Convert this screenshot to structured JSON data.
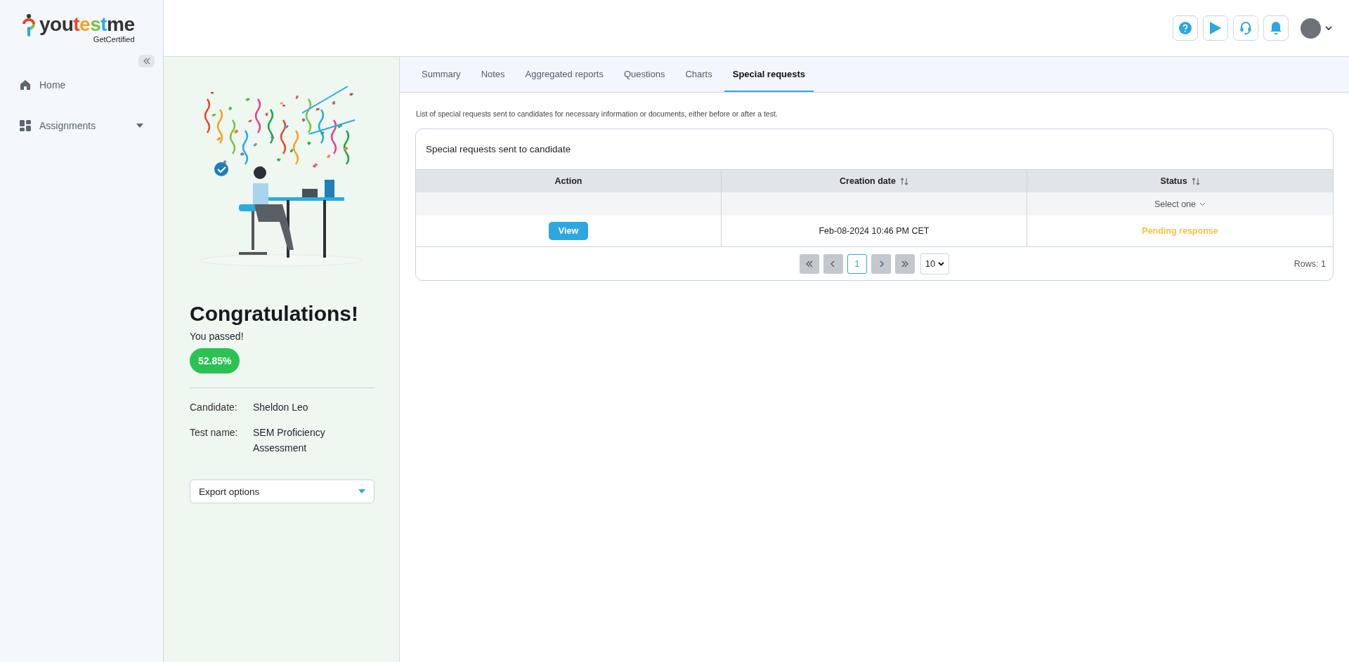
{
  "logo": {
    "parts": [
      {
        "text": "you",
        "color": "#333333"
      },
      {
        "text": "t",
        "color": "#e8452c"
      },
      {
        "text": "e",
        "color": "#f7a21b"
      },
      {
        "text": "s",
        "color": "#7cc242"
      },
      {
        "text": "t",
        "color": "#29aae1"
      },
      {
        "text": "me",
        "color": "#333333"
      }
    ],
    "tagline": "GetCertified"
  },
  "sidebar": {
    "items": [
      {
        "label": "Home",
        "expandable": false
      },
      {
        "label": "Assignments",
        "expandable": true
      }
    ]
  },
  "result": {
    "title": "Congratulations!",
    "subtitle": "You passed!",
    "score": "52.85%",
    "passed": true,
    "details": [
      {
        "label": "Candidate:",
        "value": "Sheldon Leo"
      },
      {
        "label": "Test name:",
        "value": "SEM Proficiency Assessment"
      }
    ],
    "export": {
      "value": "Export options"
    }
  },
  "tabs": [
    {
      "label": "Summary",
      "selected": false
    },
    {
      "label": "Notes",
      "selected": false
    },
    {
      "label": "Aggregated reports",
      "selected": false
    },
    {
      "label": "Questions",
      "selected": false
    },
    {
      "label": "Charts",
      "selected": false
    },
    {
      "label": "Special requests",
      "selected": true
    }
  ],
  "description": "List of special requests sent to candidates for necessary information or documents, either before or after a test.",
  "table": {
    "title": "Special requests sent to candidate",
    "columns": [
      {
        "label": "Action",
        "sortable": false
      },
      {
        "label": "Creation date",
        "sortable": true
      },
      {
        "label": "Status",
        "sortable": true,
        "filter": "Select one"
      }
    ],
    "rows": [
      {
        "action": "View",
        "date": "Feb-08-2024 10:46 PM CET",
        "status": "Pending response",
        "kind": "pending"
      }
    ],
    "pagination": {
      "pages": [
        {
          "label": "1",
          "selected": true
        }
      ],
      "page_size": "10",
      "rows": "Rows: 1"
    }
  }
}
